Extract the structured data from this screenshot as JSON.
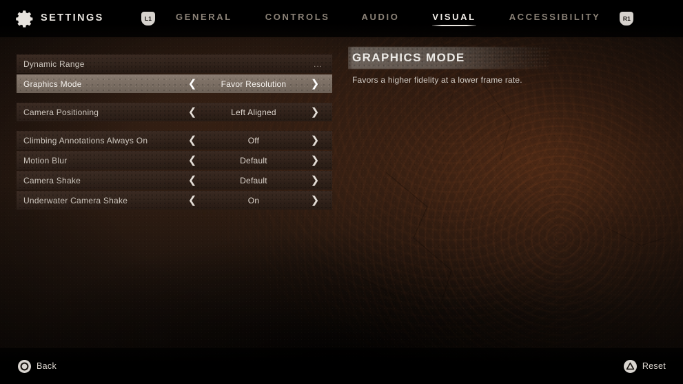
{
  "header": {
    "gear_icon": "gear-icon",
    "title": "SETTINGS",
    "left_bumper": "L1",
    "right_bumper": "R1",
    "tabs": [
      {
        "label": "GENERAL",
        "active": false
      },
      {
        "label": "CONTROLS",
        "active": false
      },
      {
        "label": "AUDIO",
        "active": false
      },
      {
        "label": "VISUAL",
        "active": true
      },
      {
        "label": "ACCESSIBILITY",
        "active": false
      }
    ]
  },
  "settings": {
    "left_arrow_glyph": "❮",
    "right_arrow_glyph": "❯",
    "groups": [
      {
        "rows": [
          {
            "label": "Dynamic Range",
            "value": "",
            "selected": false,
            "has_arrows": false,
            "ellipsis": "..."
          },
          {
            "label": "Graphics Mode",
            "value": "Favor Resolution",
            "selected": true,
            "has_arrows": true,
            "ellipsis": ""
          }
        ]
      },
      {
        "rows": [
          {
            "label": "Camera Positioning",
            "value": "Left Aligned",
            "selected": false,
            "has_arrows": true,
            "ellipsis": ""
          }
        ]
      },
      {
        "rows": [
          {
            "label": "Climbing Annotations Always On",
            "value": "Off",
            "selected": false,
            "has_arrows": true,
            "ellipsis": ""
          },
          {
            "label": "Motion Blur",
            "value": "Default",
            "selected": false,
            "has_arrows": true,
            "ellipsis": ""
          },
          {
            "label": "Camera Shake",
            "value": "Default",
            "selected": false,
            "has_arrows": true,
            "ellipsis": ""
          },
          {
            "label": "Underwater Camera Shake",
            "value": "On",
            "selected": false,
            "has_arrows": true,
            "ellipsis": ""
          }
        ]
      }
    ]
  },
  "detail": {
    "title": "GRAPHICS MODE",
    "description": "Favors a higher fidelity at a lower frame rate."
  },
  "footer": {
    "back": {
      "icon": "circle-button-icon",
      "label": "Back"
    },
    "reset": {
      "icon": "triangle-button-icon",
      "label": "Reset"
    }
  },
  "colors": {
    "accent_text": "#f2eee9",
    "muted_text": "#8b8277",
    "row_bg": "#32241c",
    "row_selected_bg": "#7d7065",
    "background": "#241710"
  }
}
